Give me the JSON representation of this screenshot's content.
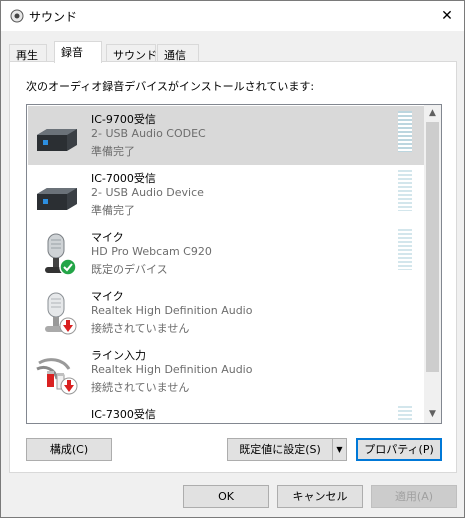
{
  "window": {
    "title": "サウンド",
    "close_glyph": "✕"
  },
  "tabs": [
    {
      "label": "再生",
      "active": false
    },
    {
      "label": "録音",
      "active": true
    },
    {
      "label": "サウンド",
      "active": false
    },
    {
      "label": "通信",
      "active": false
    }
  ],
  "panel": {
    "description": "次のオーディオ録音デバイスがインストールされています:"
  },
  "devices": [
    {
      "name": "IC-9700受信",
      "desc": "2- USB Audio CODEC",
      "status": "準備完了",
      "icon": "usb-audio-box-icon",
      "selected": true
    },
    {
      "name": "IC-7000受信",
      "desc": "2- USB Audio Device",
      "status": "準備完了",
      "icon": "usb-audio-box-icon",
      "selected": false
    },
    {
      "name": "マイク",
      "desc": "HD Pro Webcam C920",
      "status": "既定のデバイス",
      "icon": "microphone-default-icon",
      "selected": false
    },
    {
      "name": "マイク",
      "desc": "Realtek High Definition Audio",
      "status": "接続されていません",
      "icon": "microphone-unplugged-icon",
      "selected": false
    },
    {
      "name": "ライン入力",
      "desc": "Realtek High Definition Audio",
      "status": "接続されていません",
      "icon": "line-in-unplugged-icon",
      "selected": false
    },
    {
      "name": "IC-7300受信",
      "desc": "",
      "status": "",
      "icon": "usb-audio-box-icon",
      "selected": false
    }
  ],
  "buttons": {
    "configure": "構成(C)",
    "set_default": "既定値に設定(S)",
    "properties": "プロパティ(P)",
    "ok": "OK",
    "cancel": "キャンセル",
    "apply": "適用(A)"
  },
  "colors": {
    "selected_row": "#d9d9d9",
    "accent": "#0078d7",
    "check_green": "#23a547",
    "unplug_red": "#d92121"
  }
}
